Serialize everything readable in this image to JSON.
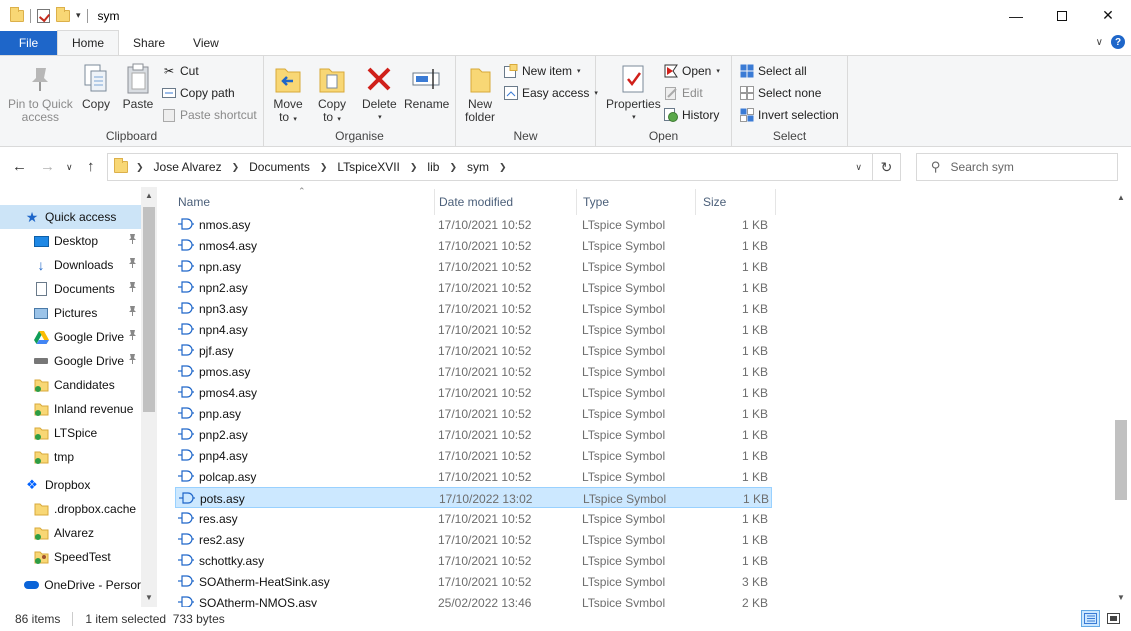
{
  "window": {
    "title": "sym"
  },
  "colors": {
    "file_tab": "#1e66c9",
    "selection": "#cce8ff",
    "nav_selection": "#cce4f7",
    "folder": "#f8d775",
    "accent": "#1e66c9"
  },
  "tabs": [
    {
      "label": "File"
    },
    {
      "label": "Home",
      "active": true
    },
    {
      "label": "Share"
    },
    {
      "label": "View"
    }
  ],
  "ribbon": {
    "clipboard": {
      "label": "Clipboard",
      "pin": "Pin to Quick\naccess",
      "pin_l1": "Pin to Quick",
      "pin_l2": "access",
      "copy": "Copy",
      "paste": "Paste",
      "cut": "Cut",
      "copy_path": "Copy path",
      "paste_shortcut": "Paste shortcut"
    },
    "organise": {
      "label": "Organise",
      "move_l1": "Move",
      "move_l2": "to",
      "copy_l1": "Copy",
      "copy_l2": "to",
      "delete": "Delete",
      "rename": "Rename"
    },
    "new": {
      "label": "New",
      "folder_l1": "New",
      "folder_l2": "folder",
      "new_item": "New item",
      "easy_access": "Easy access"
    },
    "open": {
      "label": "Open",
      "properties": "Properties",
      "open": "Open",
      "edit": "Edit",
      "history": "History"
    },
    "select": {
      "label": "Select",
      "select_all": "Select all",
      "select_none": "Select none",
      "invert": "Invert selection"
    }
  },
  "address": {
    "crumbs": [
      "Jose Alvarez",
      "Documents",
      "LTspiceXVII",
      "lib",
      "sym"
    ],
    "search_placeholder": "Search sym"
  },
  "navpane": {
    "items": [
      {
        "label": "Quick access",
        "icon": "star-icon",
        "selected": true,
        "indent": 0
      },
      {
        "label": "Desktop",
        "icon": "desktop-icon",
        "pinned": true,
        "indent": 1
      },
      {
        "label": "Downloads",
        "icon": "download-icon",
        "pinned": true,
        "indent": 1
      },
      {
        "label": "Documents",
        "icon": "documents-icon",
        "pinned": true,
        "indent": 1
      },
      {
        "label": "Pictures",
        "icon": "pictures-icon",
        "pinned": true,
        "indent": 1
      },
      {
        "label": "Google Drive",
        "icon": "google-drive-icon",
        "pinned": true,
        "indent": 1
      },
      {
        "label": "Google Drive",
        "icon": "drive-disk-icon",
        "pinned": true,
        "indent": 1
      },
      {
        "label": "Candidates",
        "icon": "synced-folder-icon",
        "indent": 1
      },
      {
        "label": "Inland revenue",
        "icon": "synced-folder-icon",
        "indent": 1
      },
      {
        "label": "LTSpice",
        "icon": "synced-folder-icon",
        "indent": 1
      },
      {
        "label": "tmp",
        "icon": "synced-folder-icon",
        "indent": 1
      },
      {
        "label": "Dropbox",
        "icon": "dropbox-icon",
        "indent": 0,
        "gap": true
      },
      {
        "label": ".dropbox.cache",
        "icon": "folder-icon",
        "indent": 1
      },
      {
        "label": "Alvarez",
        "icon": "synced-folder-icon",
        "indent": 1
      },
      {
        "label": "SpeedTest",
        "icon": "user-folder-icon",
        "indent": 1
      },
      {
        "label": "OneDrive - Persor",
        "icon": "onedrive-icon",
        "indent": 0,
        "gap": true
      }
    ]
  },
  "filelist": {
    "columns": {
      "name": "Name",
      "date": "Date modified",
      "type": "Type",
      "size": "Size"
    },
    "rows": [
      {
        "name": "nmos.asy",
        "date": "17/10/2021 10:52",
        "type": "LTspice Symbol",
        "size": "1 KB"
      },
      {
        "name": "nmos4.asy",
        "date": "17/10/2021 10:52",
        "type": "LTspice Symbol",
        "size": "1 KB"
      },
      {
        "name": "npn.asy",
        "date": "17/10/2021 10:52",
        "type": "LTspice Symbol",
        "size": "1 KB"
      },
      {
        "name": "npn2.asy",
        "date": "17/10/2021 10:52",
        "type": "LTspice Symbol",
        "size": "1 KB"
      },
      {
        "name": "npn3.asy",
        "date": "17/10/2021 10:52",
        "type": "LTspice Symbol",
        "size": "1 KB"
      },
      {
        "name": "npn4.asy",
        "date": "17/10/2021 10:52",
        "type": "LTspice Symbol",
        "size": "1 KB"
      },
      {
        "name": "pjf.asy",
        "date": "17/10/2021 10:52",
        "type": "LTspice Symbol",
        "size": "1 KB"
      },
      {
        "name": "pmos.asy",
        "date": "17/10/2021 10:52",
        "type": "LTspice Symbol",
        "size": "1 KB"
      },
      {
        "name": "pmos4.asy",
        "date": "17/10/2021 10:52",
        "type": "LTspice Symbol",
        "size": "1 KB"
      },
      {
        "name": "pnp.asy",
        "date": "17/10/2021 10:52",
        "type": "LTspice Symbol",
        "size": "1 KB"
      },
      {
        "name": "pnp2.asy",
        "date": "17/10/2021 10:52",
        "type": "LTspice Symbol",
        "size": "1 KB"
      },
      {
        "name": "pnp4.asy",
        "date": "17/10/2021 10:52",
        "type": "LTspice Symbol",
        "size": "1 KB"
      },
      {
        "name": "polcap.asy",
        "date": "17/10/2021 10:52",
        "type": "LTspice Symbol",
        "size": "1 KB"
      },
      {
        "name": "pots.asy",
        "date": "17/10/2022 13:02",
        "type": "LTspice Symbol",
        "size": "1 KB",
        "selected": true
      },
      {
        "name": "res.asy",
        "date": "17/10/2021 10:52",
        "type": "LTspice Symbol",
        "size": "1 KB"
      },
      {
        "name": "res2.asy",
        "date": "17/10/2021 10:52",
        "type": "LTspice Symbol",
        "size": "1 KB"
      },
      {
        "name": "schottky.asy",
        "date": "17/10/2021 10:52",
        "type": "LTspice Symbol",
        "size": "1 KB"
      },
      {
        "name": "SOAtherm-HeatSink.asy",
        "date": "17/10/2021 10:52",
        "type": "LTspice Symbol",
        "size": "3 KB"
      },
      {
        "name": "SOAtherm-NMOS.asy",
        "date": "25/02/2022 13:46",
        "type": "LTspice Symbol",
        "size": "2 KB"
      }
    ]
  },
  "status": {
    "count": "86 items",
    "selected": "1 item selected  733 bytes"
  }
}
